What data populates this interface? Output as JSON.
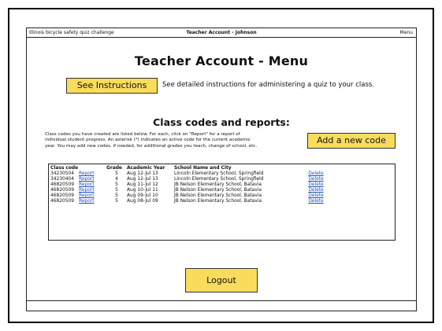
{
  "topbar": {
    "left_text": "Illinois bicycle safety quiz challenge",
    "center_text": "Teacher Account - Johnson",
    "menu_label": "Menu"
  },
  "page_title": "Teacher Account - Menu",
  "instructions": {
    "button_label": "See Instructions",
    "description": "See detailed instructions for administering a quiz to your class."
  },
  "class_codes": {
    "heading": "Class codes and reports:",
    "description_line1": "Class codes you have created are listed below.  For each, click on \"Report\" for a report of",
    "description_line2": "individual student progress.  An asterisk (*) indicates an active code for the current academic",
    "description_line3": "year.  You may add new codes, if needed, for additional grades you teach, change of school, etc.",
    "add_button_label": "Add a new code"
  },
  "table": {
    "headers": [
      "Class code",
      "",
      "Grade",
      "Academic Year",
      "School Name and City",
      ""
    ],
    "rows": [
      {
        "code": "34230504",
        "report": "Report",
        "grade": "5",
        "year": "Aug 12-Jul 13",
        "school": "Lincoln Elementary School, Springfield",
        "delete": "Delete"
      },
      {
        "code": "34230404",
        "report": "Report",
        "grade": "4",
        "year": "Aug 12-Jul 13",
        "school": "Lincoln Elementary School, Springfield",
        "delete": "Delete"
      },
      {
        "code": "46820509",
        "report": "Report",
        "grade": "5",
        "year": "Aug 11-Jul 12",
        "school": "JB Nelson Elementary School, Batavia",
        "delete": "Delete"
      },
      {
        "code": "46820509",
        "report": "Report",
        "grade": "5",
        "year": "Aug 10-Jul 11",
        "school": "JB Nelson Elementary School, Batavia",
        "delete": "Delete"
      },
      {
        "code": "46820509",
        "report": "Report",
        "grade": "5",
        "year": "Aug 09-Jul 10",
        "school": "JB Nelson Elementary School, Batavia",
        "delete": "Delete"
      },
      {
        "code": "46820509",
        "report": "Report",
        "grade": "5",
        "year": "Aug 08-Jul 09",
        "school": "JB Nelson Elementary School, Batavia",
        "delete": "Delete"
      }
    ]
  },
  "logout_label": "Logout",
  "colors": {
    "button_yellow": "#f9dc5c",
    "link_blue": "#1a4fc0"
  }
}
